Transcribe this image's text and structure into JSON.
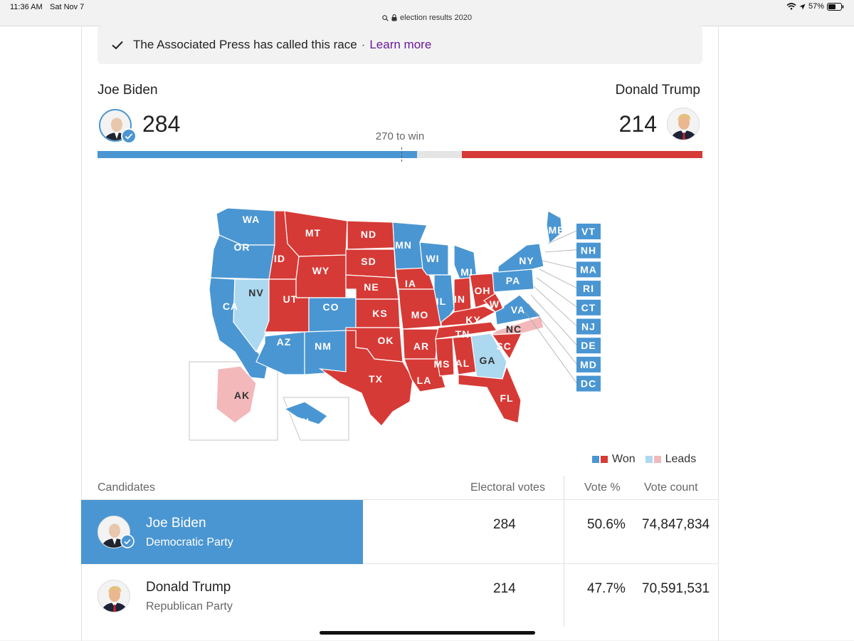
{
  "status": {
    "time": "11:36 AM",
    "date": "Sat Nov 7",
    "battery": "57%"
  },
  "url": "election results 2020",
  "banner": {
    "text": "The Associated Press has called this race",
    "sep": "·",
    "link": "Learn more"
  },
  "candidates": {
    "dem": {
      "name": "Joe Biden",
      "ev": "284",
      "party": "Democratic Party",
      "pct": "50.6%",
      "count": "74,847,834",
      "color": "#4a96d2"
    },
    "rep": {
      "name": "Donald Trump",
      "ev": "214",
      "party": "Republican Party",
      "pct": "47.7%",
      "count": "70,591,531",
      "color": "#d63a36"
    }
  },
  "progress": {
    "dem_ev": 284,
    "rep_ev": 214,
    "total_ev": 538,
    "win_ev": 270,
    "label": "270 to win"
  },
  "map": {
    "colors": {
      "dem_won": "#4a96d2",
      "rep_won": "#d63a36",
      "dem_lead": "#acd8f0",
      "rep_lead": "#f2b8ba"
    },
    "states": [
      {
        "abbr": "WA",
        "status": "dem_won"
      },
      {
        "abbr": "OR",
        "status": "dem_won"
      },
      {
        "abbr": "CA",
        "status": "dem_won"
      },
      {
        "abbr": "NV",
        "status": "dem_lead"
      },
      {
        "abbr": "ID",
        "status": "rep_won"
      },
      {
        "abbr": "MT",
        "status": "rep_won"
      },
      {
        "abbr": "WY",
        "status": "rep_won"
      },
      {
        "abbr": "UT",
        "status": "rep_won"
      },
      {
        "abbr": "AZ",
        "status": "dem_won"
      },
      {
        "abbr": "CO",
        "status": "dem_won"
      },
      {
        "abbr": "NM",
        "status": "dem_won"
      },
      {
        "abbr": "ND",
        "status": "rep_won"
      },
      {
        "abbr": "SD",
        "status": "rep_won"
      },
      {
        "abbr": "NE",
        "status": "rep_won"
      },
      {
        "abbr": "KS",
        "status": "rep_won"
      },
      {
        "abbr": "OK",
        "status": "rep_won"
      },
      {
        "abbr": "TX",
        "status": "rep_won"
      },
      {
        "abbr": "MN",
        "status": "dem_won"
      },
      {
        "abbr": "IA",
        "status": "rep_won"
      },
      {
        "abbr": "MO",
        "status": "rep_won"
      },
      {
        "abbr": "AR",
        "status": "rep_won"
      },
      {
        "abbr": "LA",
        "status": "rep_won"
      },
      {
        "abbr": "WI",
        "status": "dem_won"
      },
      {
        "abbr": "IL",
        "status": "dem_won"
      },
      {
        "abbr": "MI",
        "status": "dem_won"
      },
      {
        "abbr": "IN",
        "status": "rep_won"
      },
      {
        "abbr": "OH",
        "status": "rep_won"
      },
      {
        "abbr": "KY",
        "status": "rep_won"
      },
      {
        "abbr": "TN",
        "status": "rep_won"
      },
      {
        "abbr": "MS",
        "status": "rep_won"
      },
      {
        "abbr": "AL",
        "status": "rep_won"
      },
      {
        "abbr": "GA",
        "status": "dem_lead"
      },
      {
        "abbr": "FL",
        "status": "rep_won"
      },
      {
        "abbr": "SC",
        "status": "rep_won"
      },
      {
        "abbr": "NC",
        "status": "rep_lead"
      },
      {
        "abbr": "VA",
        "status": "dem_won"
      },
      {
        "abbr": "WV",
        "status": "rep_won"
      },
      {
        "abbr": "PA",
        "status": "dem_won"
      },
      {
        "abbr": "NY",
        "status": "dem_won"
      },
      {
        "abbr": "ME",
        "status": "dem_won"
      },
      {
        "abbr": "AK",
        "status": "rep_lead"
      },
      {
        "abbr": "HI",
        "status": "dem_won"
      }
    ],
    "small_states": [
      "VT",
      "NH",
      "MA",
      "RI",
      "CT",
      "NJ",
      "DE",
      "MD",
      "DC"
    ]
  },
  "legend": {
    "won": "Won",
    "leads": "Leads"
  },
  "table": {
    "col_candidates": "Candidates",
    "col_electoral": "Electoral votes",
    "col_pct": "Vote %",
    "col_count": "Vote count"
  }
}
